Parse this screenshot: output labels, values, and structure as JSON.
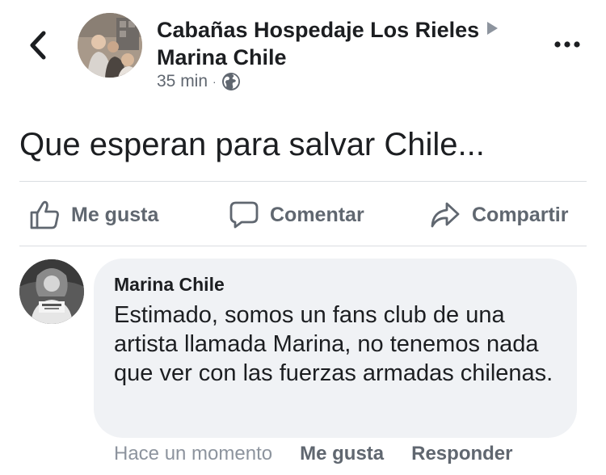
{
  "header": {
    "author": "Cabañas Hospedaje Los Rieles",
    "target": "Marina Chile",
    "time": "35 min",
    "separator": "·",
    "privacy_icon": "globe-icon",
    "back_icon": "chevron-left-icon",
    "more_icon": "more-horizontal-icon"
  },
  "post": {
    "text": "Que esperan para salvar Chile..."
  },
  "actions": {
    "like": "Me gusta",
    "comment": "Comentar",
    "share": "Compartir"
  },
  "comment": {
    "author": "Marina Chile",
    "text": "Estimado, somos un fans club de una artista llamada Marina, no tenemos nada que ver con las fuerzas armadas chilenas.",
    "time": "Hace un momento",
    "like": "Me gusta",
    "reply": "Responder"
  },
  "colors": {
    "text": "#1c1e21",
    "secondary": "#606770",
    "muted": "#8d949e",
    "bubble": "#f0f2f5",
    "divider": "#dadde1"
  }
}
